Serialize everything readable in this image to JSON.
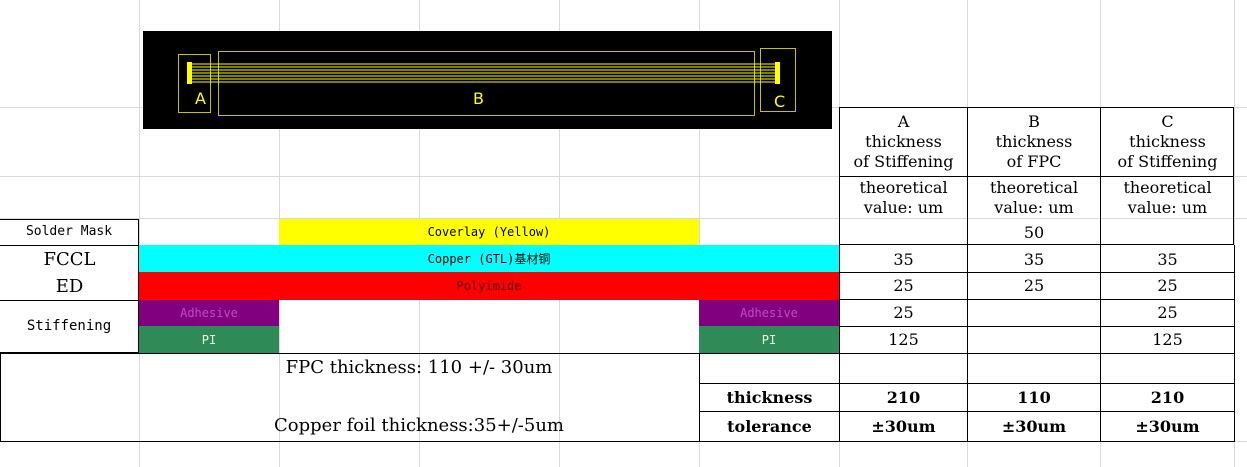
{
  "colors": {
    "coverlay": "#ffff00",
    "copper": "#00ffff",
    "polyimide": "#ff0000",
    "adhesive": "#800080",
    "pi": "#2e8b57",
    "diagram_bg": "#000000",
    "diagram_lines": "#ffff00"
  },
  "diagram": {
    "label_a": "A",
    "label_b": "B",
    "label_c": "C"
  },
  "header": {
    "col_a": "A\nthickness\nof Stiffening",
    "col_b": "B\nthickness\nof FPC",
    "col_c": "C\nthickness\nof Stiffening",
    "unit_a": "theoretical\nvalue: um",
    "unit_b": "theoretical\nvalue: um",
    "unit_c": "theoretical\nvalue: um"
  },
  "layers": {
    "solder_mask_label": "Solder Mask",
    "fccl_label": "FCCL",
    "ed_label": "ED",
    "stiffening_label": "Stiffening",
    "coverlay_text": "Coverlay (Yellow)",
    "copper_text": "Copper (GTL)基材铜",
    "polyimide_text": "Polyimide",
    "adhesive_left": "Adhesive",
    "adhesive_right": "Adhesive",
    "pi_left": "PI",
    "pi_right": "PI"
  },
  "values": {
    "coverlay": {
      "a": "",
      "b": "50",
      "c": ""
    },
    "copper": {
      "a": "35",
      "b": "35",
      "c": "35"
    },
    "polyimide": {
      "a": "25",
      "b": "25",
      "c": "25"
    },
    "adhesive": {
      "a": "25",
      "b": "",
      "c": "25"
    },
    "pi": {
      "a": "125",
      "b": "",
      "c": "125"
    }
  },
  "notes": {
    "fpc_thickness": "FPC thickness: 110 +/- 30um",
    "copper_foil": "Copper foil thickness:35+/-5um"
  },
  "summary": {
    "thickness_label": "thickness",
    "tolerance_label": "tolerance",
    "thickness": {
      "a": "210",
      "b": "110",
      "c": "210"
    },
    "tolerance": {
      "a": "±30um",
      "b": "±30um",
      "c": "±30um"
    }
  }
}
